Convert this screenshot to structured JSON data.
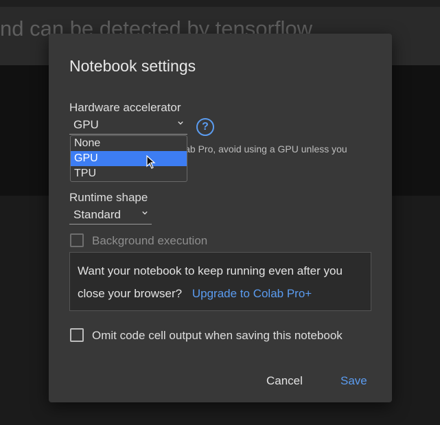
{
  "background": {
    "heading": "nd can be detected by tensorflow"
  },
  "dialog": {
    "title": "Notebook settings",
    "hardware": {
      "label": "Hardware accelerator",
      "selected": "GPU",
      "help_icon": "help-circle-icon",
      "note_fragment": "lab Pro, avoid using a GPU unless you",
      "options": [
        "None",
        "GPU",
        "TPU"
      ],
      "highlighted_option": "GPU"
    },
    "runtime": {
      "label": "Runtime shape",
      "selected": "Standard"
    },
    "background_execution": {
      "label": "Background execution",
      "checked": false,
      "disabled": true
    },
    "promo": {
      "line1": "Want your notebook to keep running even after you",
      "line2": "close your browser?",
      "link": "Upgrade to Colab Pro+"
    },
    "omit_output": {
      "label": "Omit code cell output when saving this notebook",
      "checked": false
    },
    "actions": {
      "cancel": "Cancel",
      "save": "Save"
    }
  },
  "colors": {
    "accent": "#5b9cf0",
    "selection": "#3d7df3",
    "dialog_bg": "#383838"
  }
}
